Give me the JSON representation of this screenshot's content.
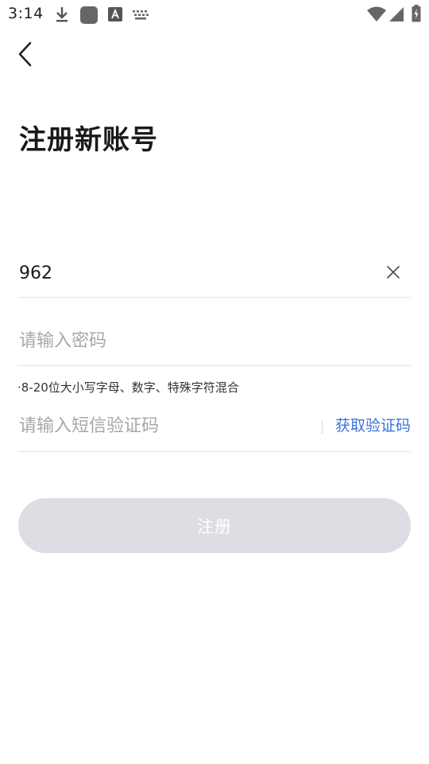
{
  "status_bar": {
    "time": "3:14",
    "icons": [
      "download-icon",
      "app-icon",
      "text-a-icon",
      "keyboard-icon",
      "wifi-icon",
      "signal-icon",
      "battery-icon"
    ]
  },
  "header": {
    "back_icon": "back-chevron-icon"
  },
  "page": {
    "title": "注册新账号"
  },
  "form": {
    "phone": {
      "value": "962",
      "clear_icon": "close-icon"
    },
    "password": {
      "placeholder": "请输入密码",
      "hint": "·8-20位大小写字母、数字、特殊字符混合"
    },
    "sms_code": {
      "placeholder": "请输入短信验证码",
      "get_code_label": "获取验证码"
    },
    "submit_label": "注册"
  },
  "colors": {
    "link": "#3a73d9",
    "button_disabled": "#dcdee4",
    "divider": "#e3e3e3",
    "placeholder": "#a7a7a7"
  }
}
